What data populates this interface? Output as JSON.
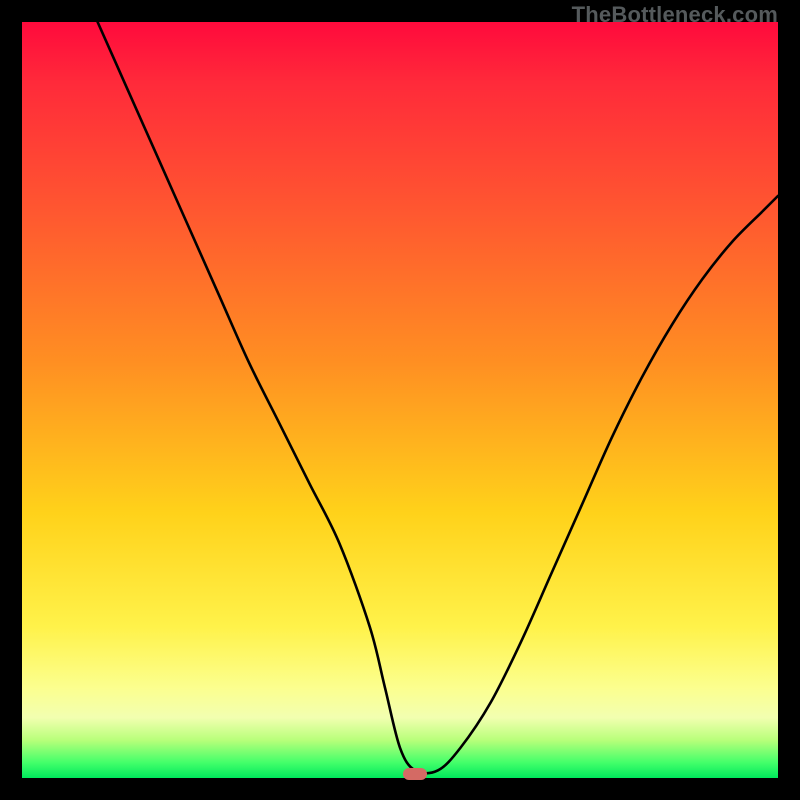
{
  "watermark": "TheBottleneck.com",
  "chart_data": {
    "type": "line",
    "title": "",
    "xlabel": "",
    "ylabel": "",
    "xlim": [
      0,
      100
    ],
    "ylim": [
      0,
      100
    ],
    "grid": false,
    "legend": false,
    "series": [
      {
        "name": "bottleneck-curve",
        "x": [
          10,
          14,
          18,
          22,
          26,
          30,
          34,
          38,
          42,
          46,
          48,
          50,
          52,
          55,
          58,
          62,
          66,
          70,
          74,
          78,
          82,
          86,
          90,
          94,
          98,
          100
        ],
        "y": [
          100,
          91,
          82,
          73,
          64,
          55,
          47,
          39,
          31,
          20,
          12,
          4,
          1,
          1,
          4,
          10,
          18,
          27,
          36,
          45,
          53,
          60,
          66,
          71,
          75,
          77
        ]
      }
    ],
    "marker": {
      "x": 52,
      "y": 0.5,
      "color": "#d46a64"
    },
    "background_gradient": [
      "#ff0a3c",
      "#ff5730",
      "#ffd21a",
      "#fcff8e",
      "#00e85c"
    ]
  }
}
